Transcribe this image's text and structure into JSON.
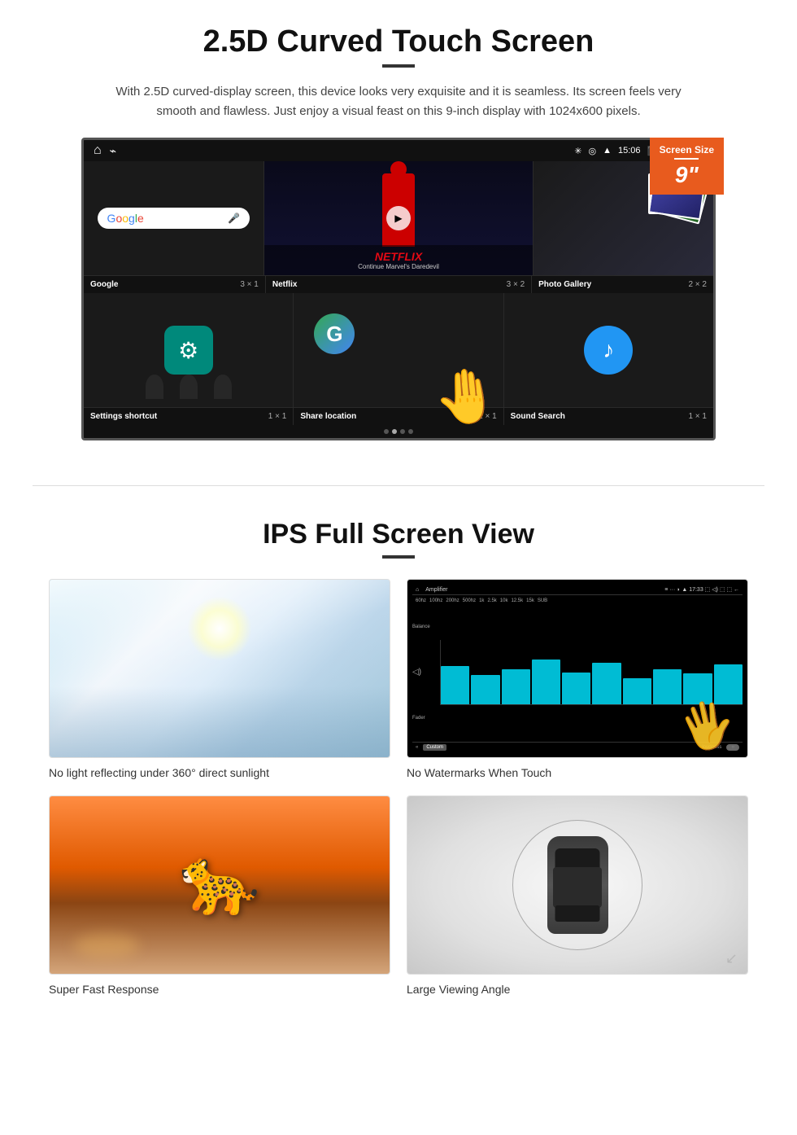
{
  "section1": {
    "title": "2.5D Curved Touch Screen",
    "description": "With 2.5D curved-display screen, this device looks very exquisite and it is seamless. Its screen feels very smooth and flawless. Just enjoy a visual feast on this 9-inch display with 1024x600 pixels.",
    "screen_badge": {
      "label": "Screen Size",
      "size": "9\""
    },
    "status_bar": {
      "time": "15:06"
    },
    "apps_row1": [
      {
        "name": "Google",
        "size": "3 × 1"
      },
      {
        "name": "Netflix",
        "size": "3 × 2"
      },
      {
        "name": "Photo Gallery",
        "size": "2 × 2"
      }
    ],
    "apps_row2": [
      {
        "name": "Settings shortcut",
        "size": "1 × 1"
      },
      {
        "name": "Share location",
        "size": "1 × 1"
      },
      {
        "name": "Sound Search",
        "size": "1 × 1"
      }
    ],
    "netflix_text": "NETFLIX",
    "netflix_subtitle": "Continue Marvel's Daredevil"
  },
  "section2": {
    "title": "IPS Full Screen View",
    "features": [
      {
        "caption": "No light reflecting under 360° direct sunlight",
        "type": "sunlight"
      },
      {
        "caption": "No Watermarks When Touch",
        "type": "amplifier"
      },
      {
        "caption": "Super Fast Response",
        "type": "cheetah"
      },
      {
        "caption": "Large Viewing Angle",
        "type": "car"
      }
    ]
  }
}
